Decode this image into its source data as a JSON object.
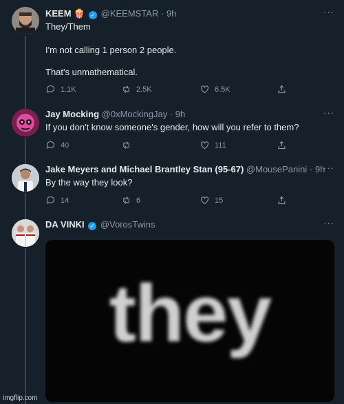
{
  "tweets": [
    {
      "name": "KEEM",
      "name_emoji": "🍿",
      "verified": true,
      "handle": "@KEEMSTAR",
      "time": "· 9h",
      "lines": [
        "They/Them",
        "I'm not calling 1 person 2 people.",
        "That's unmathematical."
      ],
      "replies": "1.1K",
      "retweets": "2.5K",
      "likes": "6.5K"
    },
    {
      "name": "Jay Mocking",
      "handle": "@0xMockingJay",
      "time": "· 9h",
      "lines": [
        "If you don't know someone's gender, how will you refer to them?"
      ],
      "replies": "40",
      "retweets": "",
      "likes": "111"
    },
    {
      "name": "Jake Meyers and Michael Brantley Stan (95-67)",
      "handle": "@MousePanini",
      "time": "· 9h",
      "lines": [
        "By the way they look?"
      ],
      "replies": "14",
      "retweets": "6",
      "likes": "15"
    },
    {
      "name": "DA VINKI",
      "verified": true,
      "handle": "@VorosTwins",
      "media_text": "they"
    }
  ],
  "more_label": "···",
  "watermark": "imgflip.com",
  "colors": {
    "background": "#15202b",
    "handle": "#8b98a5",
    "verified": "#1d9bf0",
    "divider": "#38444d"
  },
  "icons": [
    "reply-icon",
    "retweet-icon",
    "like-icon",
    "share-icon",
    "more-icon",
    "verified-icon"
  ]
}
